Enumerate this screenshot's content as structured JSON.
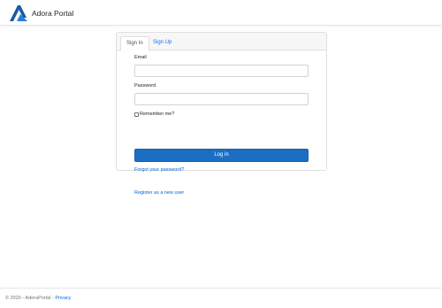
{
  "brand": {
    "name": "Adora Portal",
    "logo_color": "#1b6ec2",
    "logo_icon": "adora-logo"
  },
  "tabs": [
    {
      "label": "Sign In",
      "active": true
    },
    {
      "label": "Sign Up",
      "active": false
    }
  ],
  "form": {
    "email_label": "Email",
    "email_value": "",
    "password_label": "Password",
    "password_value": "",
    "remember_label": "Remember me?",
    "remember_checked": false,
    "login_label": "Log in",
    "forgot_link": "Forgot your password?",
    "register_link": "Register as a new user"
  },
  "footer": {
    "copyright": "© 2020 - AdoraPortal - ",
    "privacy_link": "Privacy"
  },
  "colors": {
    "primary": "#1b6ec2",
    "link": "#0366d6"
  }
}
